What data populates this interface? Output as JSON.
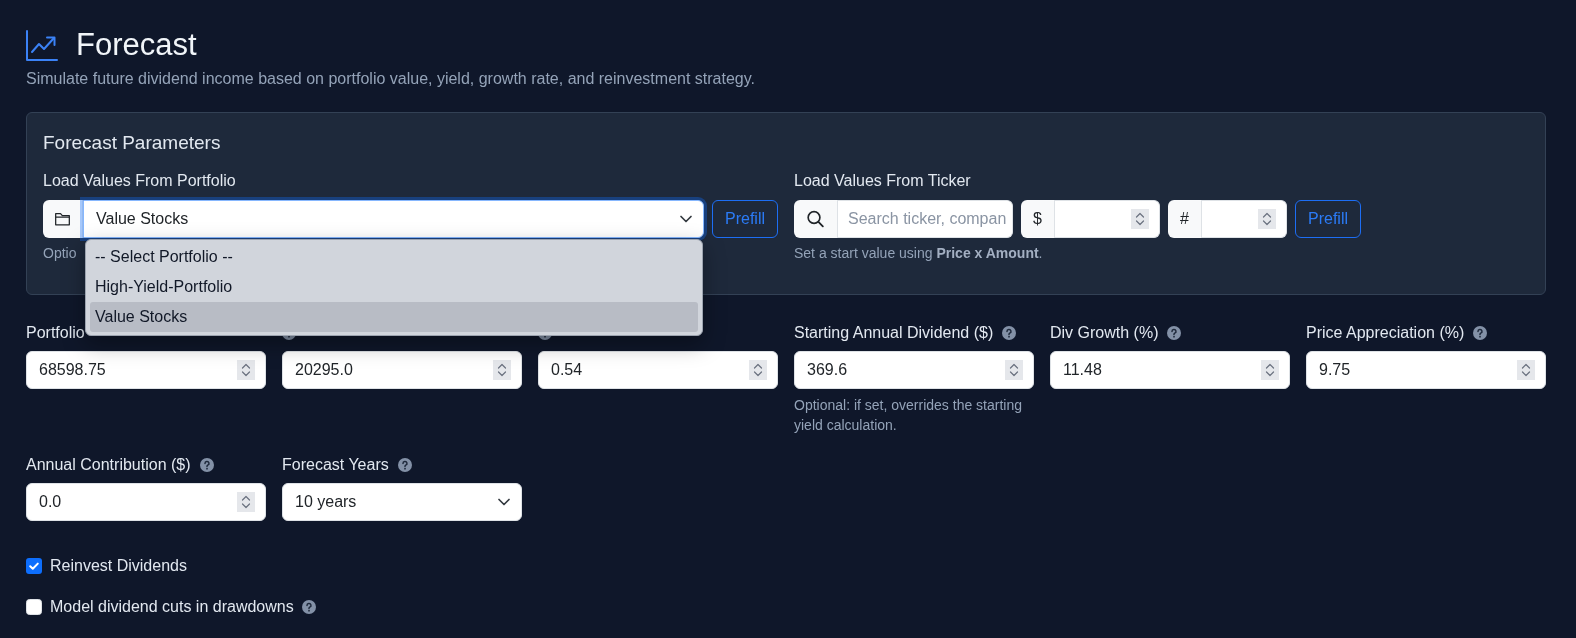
{
  "header": {
    "title": "Forecast",
    "subtitle": "Simulate future dividend income based on portfolio value, yield, growth rate, and reinvestment strategy."
  },
  "parameters": {
    "title": "Forecast Parameters",
    "portfolio_loader": {
      "label": "Load Values From Portfolio",
      "select": {
        "value": "Value Stocks",
        "focused": true
      },
      "button": "Prefill",
      "hint": "Optio",
      "dropdown": {
        "options": [
          {
            "label": "-- Select Portfolio --",
            "selected": false
          },
          {
            "label": "High-Yield-Portfolio",
            "selected": false
          },
          {
            "label": "Value Stocks",
            "selected": true
          }
        ]
      }
    },
    "ticker_loader": {
      "label": "Load Values From Ticker",
      "search": {
        "placeholder": "Search ticker, compan"
      },
      "price": {
        "prefix": "$"
      },
      "amount": {
        "prefix": "#"
      },
      "button": "Prefill",
      "hint": "Set a start value using **Price x Amount**."
    }
  },
  "fields": [
    {
      "kind": "number",
      "label": "Portfolio",
      "help": false,
      "value": "68598.75"
    },
    {
      "kind": "number",
      "help": true,
      "value": "20295.0"
    },
    {
      "kind": "number",
      "help": true,
      "value": "0.54"
    },
    {
      "kind": "number",
      "label": "Starting Annual Dividend ($)",
      "help": true,
      "value": "369.6",
      "hint": "Optional: if set, overrides the starting yield calculation."
    },
    {
      "kind": "number",
      "label": "Div Growth (%)",
      "help": true,
      "value": "11.48"
    },
    {
      "kind": "number",
      "label": "Price Appreciation (%)",
      "help": true,
      "value": "9.75"
    },
    {
      "kind": "number",
      "label": "Annual Contribution ($)",
      "help": true,
      "value": "0.0"
    },
    {
      "kind": "select",
      "label": "Forecast Years",
      "help": true,
      "value": "10 years"
    }
  ],
  "checkboxes": [
    {
      "label": "Reinvest Dividends",
      "checked": true,
      "help": false
    },
    {
      "label": "Model dividend cuts in drawdowns",
      "checked": false,
      "help": true
    }
  ]
}
